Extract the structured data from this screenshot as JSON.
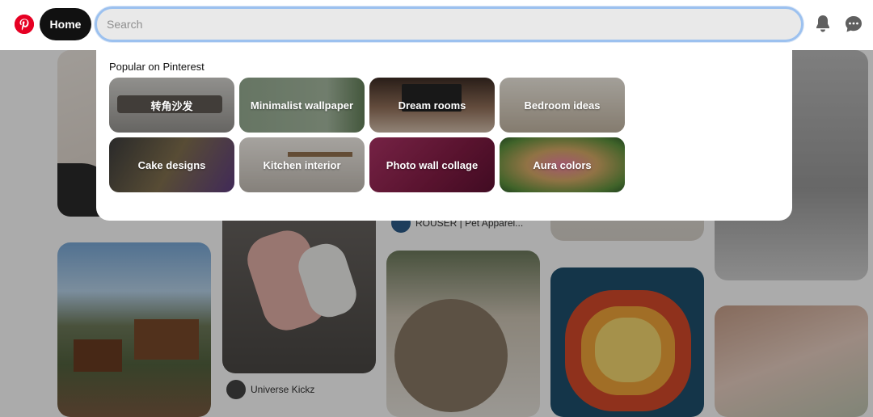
{
  "header": {
    "home_label": "Home",
    "search_placeholder": "Search",
    "search_value": ""
  },
  "dropdown": {
    "title": "Popular on Pinterest",
    "tiles": [
      {
        "label": "转角沙发",
        "color": "#9a9a98"
      },
      {
        "label": "Minimalist wallpaper",
        "color": "#7f917a"
      },
      {
        "label": "Dream rooms",
        "color": "#6b4a3c"
      },
      {
        "label": "Bedroom ideas",
        "color": "#b8ac9a"
      },
      {
        "label": "Cake designs",
        "color": "#5a4a3a"
      },
      {
        "label": "Kitchen interior",
        "color": "#b9b3ab"
      },
      {
        "label": "Photo wall collage",
        "color": "#8a1f4a"
      },
      {
        "label": "Aura colors",
        "color": "#5a7a3a"
      }
    ]
  },
  "feed": {
    "authors": [
      {
        "name": "Universe Kickz"
      },
      {
        "name": "ROUSER | Pet Apparel..."
      }
    ]
  },
  "colors": {
    "brand": "#e60023",
    "home_bg": "#111111",
    "search_focus": "#9cc1ef"
  }
}
